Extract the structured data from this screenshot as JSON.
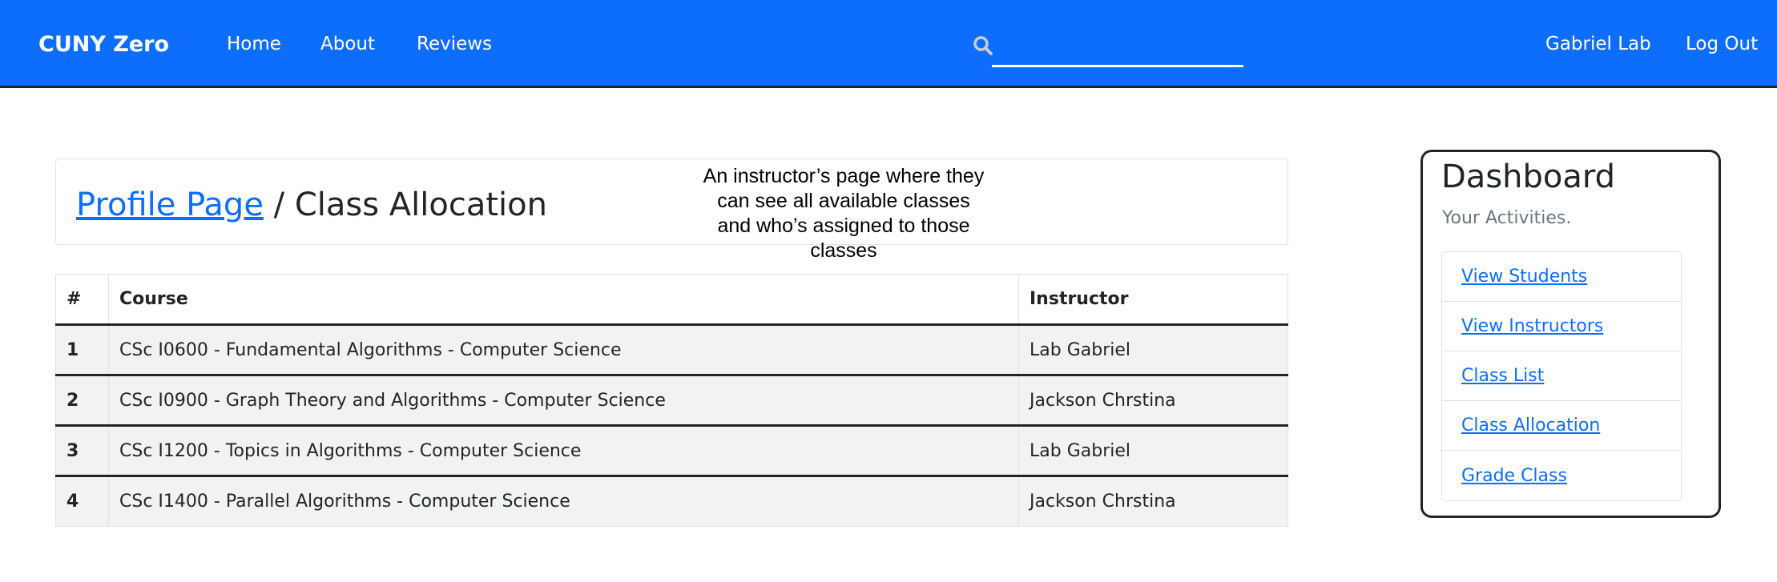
{
  "navbar": {
    "brand": "CUNY Zero",
    "links": {
      "home": "Home",
      "about": "About",
      "reviews": "Reviews"
    },
    "search": {
      "value": "",
      "placeholder": ""
    },
    "user_name": "Gabriel Lab",
    "logout": "Log Out",
    "bg_color": "#0d6efd"
  },
  "page": {
    "breadcrumb_link": "Profile Page",
    "breadcrumb_sep": " / ",
    "title": "Class Allocation",
    "annotation": "An instructor’s page where they can see all available classes and who’s assigned to those classes"
  },
  "table": {
    "headers": {
      "num": "#",
      "course": "Course",
      "instructor": "Instructor"
    },
    "rows": [
      {
        "num": "1",
        "course": "CSc I0600 - Fundamental Algorithms - Computer Science",
        "instructor": "Lab Gabriel"
      },
      {
        "num": "2",
        "course": "CSc I0900 - Graph Theory and Algorithms - Computer Science",
        "instructor": "Jackson Chrstina"
      },
      {
        "num": "3",
        "course": "CSc I1200 - Topics in Algorithms - Computer Science",
        "instructor": "Lab Gabriel"
      },
      {
        "num": "4",
        "course": "CSc I1400 - Parallel Algorithms - Computer Science",
        "instructor": "Jackson Chrstina"
      }
    ]
  },
  "dashboard": {
    "title": "Dashboard",
    "subtitle": "Your Activities.",
    "items": [
      {
        "label": "View Students"
      },
      {
        "label": "View Instructors"
      },
      {
        "label": "Class List"
      },
      {
        "label": "Class Allocation"
      },
      {
        "label": "Grade Class"
      }
    ]
  },
  "icons": {
    "search": "search-icon"
  }
}
